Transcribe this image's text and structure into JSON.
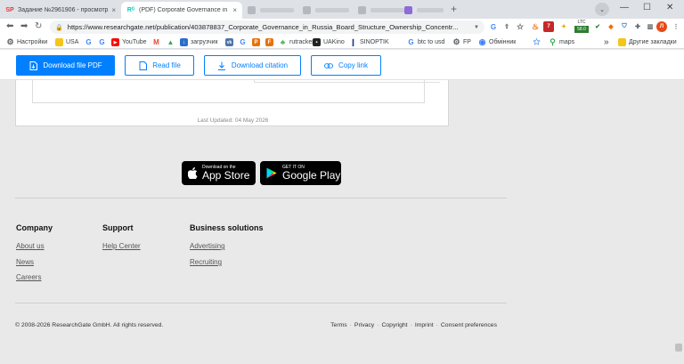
{
  "browser": {
    "tabs": [
      {
        "favicon": "SP",
        "title": "Задание №2961906 - просмотр з",
        "close": "×"
      },
      {
        "favicon": "Rᴳ",
        "title": "(PDF) Corporate Governance in Ru",
        "close": "×"
      }
    ],
    "new_tab": "+",
    "window_controls": [
      "⌄",
      "—",
      "☐",
      "✕"
    ],
    "url": "https://www.researchgate.net/publication/403878837_Corporate_Governance_in_Russia_Board_Structure_Ownership_Concentr...",
    "ext_badge": "7",
    "ltc_label": "LTC",
    "ltc_value": "58.0",
    "bookmarks": [
      {
        "label": "Настройки",
        "icon": "gear-icon",
        "color": "#5f6368"
      },
      {
        "label": "USA",
        "icon": "folder-icon",
        "color": "#f5c518"
      },
      {
        "label": "",
        "icon": "google-icon",
        "color": "#4285f4"
      },
      {
        "label": "",
        "icon": "google-icon",
        "color": "#4285f4"
      },
      {
        "label": "YouTube",
        "icon": "youtube-icon",
        "color": "#ff0000"
      },
      {
        "label": "",
        "icon": "gmail-icon",
        "color": "#ea4335"
      },
      {
        "label": "",
        "icon": "drive-icon",
        "color": "#34a853"
      },
      {
        "label": "загрузчик",
        "icon": "download-icon",
        "color": "#2a6fc9"
      },
      {
        "label": "",
        "icon": "vk-icon",
        "color": "#4a76a8"
      },
      {
        "label": "",
        "icon": "google-icon",
        "color": "#4285f4"
      },
      {
        "label": "",
        "icon": "puzzle-icon",
        "color": "#e8710a"
      },
      {
        "label": "",
        "icon": "forms-icon",
        "color": "#e8710a"
      },
      {
        "label": "rutracker",
        "icon": "leaf-icon",
        "color": "#4caf50"
      },
      {
        "label": "UAKino",
        "icon": "film-icon",
        "color": "#222222"
      },
      {
        "label": "SINOPTIK",
        "icon": "thermometer-icon",
        "color": "#1e3a8a"
      },
      {
        "label": "btc to usd",
        "icon": "google-icon",
        "color": "#4285f4"
      },
      {
        "label": "FP",
        "icon": "gear-icon",
        "color": "#5f6368"
      },
      {
        "label": "Обмінник",
        "icon": "exchange-icon",
        "color": "#3b82f6"
      },
      {
        "label": "maps",
        "icon": "map-pin-icon",
        "color": "#34a853"
      }
    ],
    "bookmarks_overflow": "»",
    "other_bookmarks": "Другие закладки"
  },
  "actions": {
    "download_pdf": "Download file PDF",
    "read_file": "Read file",
    "download_citation": "Download citation",
    "copy_link": "Copy link"
  },
  "paper": {
    "last_updated": "Last Updated: 04 May 2026"
  },
  "stores": {
    "app_store_small": "Download on the",
    "app_store_big": "App Store",
    "google_small": "GET IT ON",
    "google_big": "Google Play"
  },
  "footer": {
    "company": {
      "heading": "Company",
      "links": [
        "About us",
        "News",
        "Careers"
      ]
    },
    "support": {
      "heading": "Support",
      "links": [
        "Help Center"
      ]
    },
    "business": {
      "heading": "Business solutions",
      "links": [
        "Advertising",
        "Recruiting"
      ]
    },
    "copyright": "© 2008-2026 ResearchGate GmbH. All rights reserved.",
    "legal": [
      "Terms",
      "Privacy",
      "Copyright",
      "Imprint",
      "Consent preferences"
    ]
  },
  "colors": {
    "primary": "#0080ff",
    "page_bg": "#e9e9e9"
  }
}
